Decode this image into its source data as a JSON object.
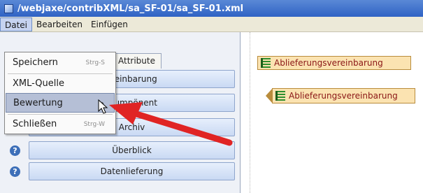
{
  "window": {
    "title": "/webjaxe/contribXML/sa_SF-01/sa_SF-01.xml"
  },
  "menubar": {
    "items": [
      "Datei",
      "Bearbeiten",
      "Einfügen"
    ]
  },
  "tabs": [
    "Attribute"
  ],
  "sidebar_buttons": [
    {
      "label": "...einbarung"
    },
    {
      "label": "...umpönent"
    },
    {
      "label": "Archiv"
    },
    {
      "label": "Überblick"
    },
    {
      "label": "Datenlieferung"
    }
  ],
  "dropdown": {
    "items": [
      {
        "label": "Speichern",
        "shortcut": "Strg-S"
      },
      {
        "label": "XML-Quelle",
        "shortcut": ""
      },
      {
        "label": "Bewertung",
        "shortcut": "",
        "selected": true
      },
      {
        "label": "Schließen",
        "shortcut": "Strg-W"
      }
    ]
  },
  "tree": {
    "node1": "Ablieferungsvereinbarung",
    "node2": "Ablieferungsvereinbarung"
  },
  "colors": {
    "arrow": "#e02424",
    "node_fill": "#fbe3b1",
    "node_text": "#8a1616"
  },
  "icons": [
    "app-icon",
    "help-icon",
    "list-icon",
    "mouse-cursor-icon",
    "red-arrow-annotation"
  ]
}
